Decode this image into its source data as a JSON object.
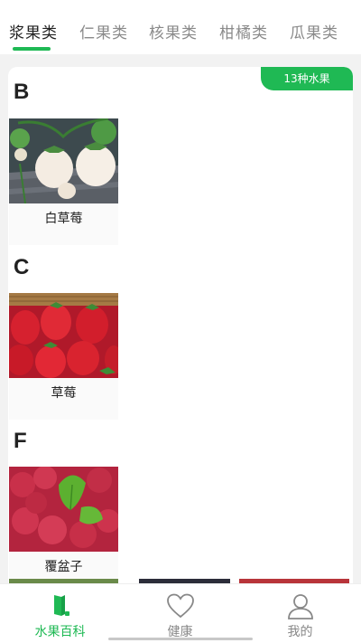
{
  "tabs": [
    {
      "label": "浆果类",
      "active": true
    },
    {
      "label": "仁果类",
      "active": false
    },
    {
      "label": "核果类",
      "active": false
    },
    {
      "label": "柑橘类",
      "active": false
    },
    {
      "label": "瓜果类",
      "active": false
    }
  ],
  "card": {
    "count_badge": "13种水果",
    "groups": [
      {
        "letter": "B",
        "fruit": {
          "name": "白草莓",
          "image": "white-strawberry-photo"
        }
      },
      {
        "letter": "C",
        "fruit": {
          "name": "草莓",
          "image": "strawberry-photo"
        }
      },
      {
        "letter": "F",
        "fruit": {
          "name": "覆盆子",
          "image": "raspberry-photo"
        }
      }
    ]
  },
  "bottom_nav": [
    {
      "label": "水果百科",
      "icon": "book-icon",
      "active": true
    },
    {
      "label": "健康",
      "icon": "heart-icon",
      "active": false
    },
    {
      "label": "我的",
      "icon": "user-icon",
      "active": false
    }
  ],
  "colors": {
    "accent": "#1fb954",
    "text": "#222222",
    "muted": "#8a8a8a",
    "background": "#f2f2f2"
  }
}
